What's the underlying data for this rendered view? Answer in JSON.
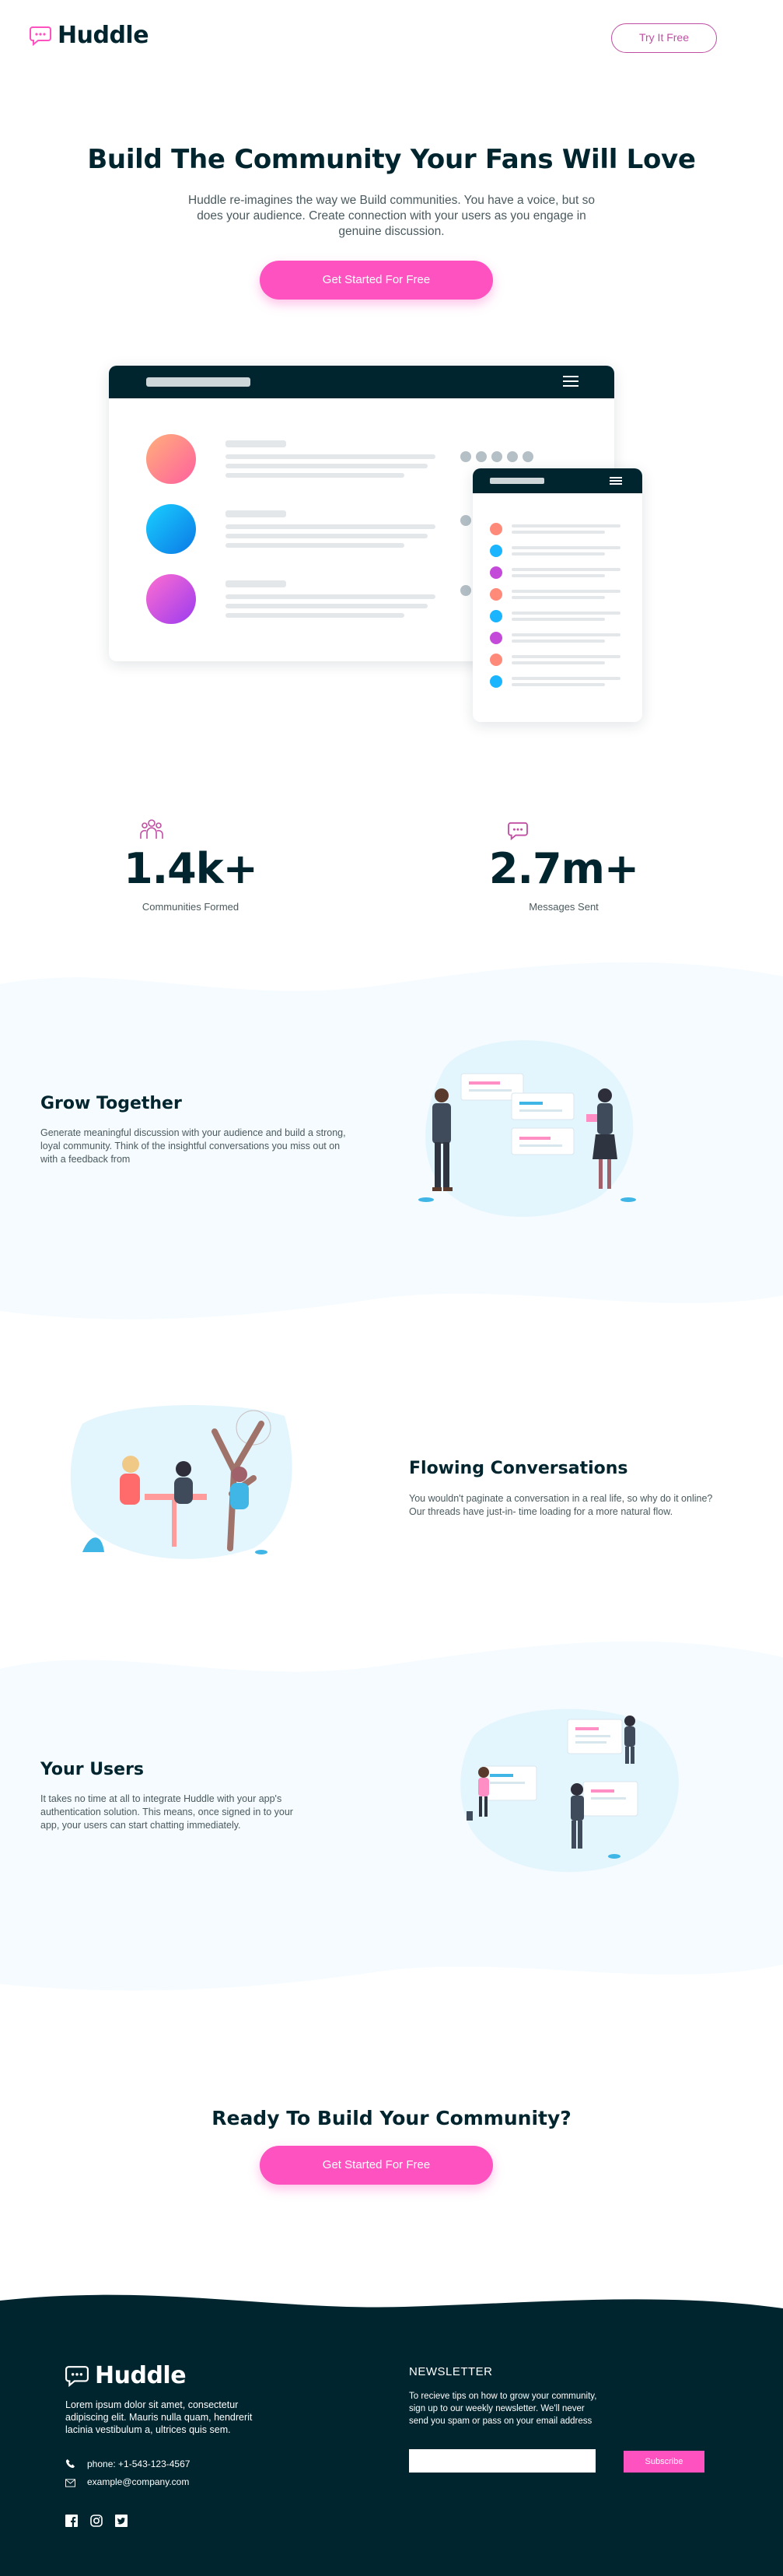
{
  "colors": {
    "dark": "#00252e",
    "pink": "#ff52c1",
    "pink_outline": "#c04fa3",
    "light_bg": "#f5fbff",
    "text": "#4a5a5e"
  },
  "header": {
    "brand": "Huddle",
    "cta": "Try It Free",
    "logo_icon": "chat-bubble-icon"
  },
  "hero": {
    "title": "Build The Community Your Fans Will Love",
    "text": "Huddle re-imagines the way we Build communities. You have a voice, but so does your audience. Create connection with your users as you engage in genuine discussion.",
    "cta": "Get Started For Free"
  },
  "stats": [
    {
      "icon": "communities-icon",
      "value": "1.4k+",
      "label": "Communities Formed"
    },
    {
      "icon": "messages-icon",
      "value": "2.7m+",
      "label": "Messages Sent"
    }
  ],
  "features": [
    {
      "title": "Grow Together",
      "text": "Generate meaningful discussion with your audience and build a strong, loyal community. Think of the insightful conversations you miss out on with a feedback from"
    },
    {
      "title": "Flowing Conversations",
      "text": "You wouldn't paginate a conversation in a real life, so why do it online? Our threads have just-in- time loading for a more natural flow."
    },
    {
      "title": "Your Users",
      "text": "It takes no time at all to integrate Huddle with your app's authentication solution. This means, once signed in to your app, your users can start chatting immediately."
    }
  ],
  "cta": {
    "title": "Ready To Build Your Community?",
    "button": "Get Started For Free"
  },
  "footer": {
    "brand": "Huddle",
    "about": "Lorem ipsum dolor sit amet, consectetur adipiscing elit. Mauris nulla quam, hendrerit lacinia vestibulum a, ultrices quis sem.",
    "phone": "phone: +1-543-123-4567",
    "email": "example@company.com",
    "newsletter_title": "NEWSLETTER",
    "newsletter_text": "To recieve tips on how to grow your community, sign up to our weekly newsletter. We'll never send you spam or pass on your email address",
    "email_placeholder": "",
    "subscribe": "Subscribe",
    "socials": [
      "facebook-icon",
      "instagram-icon",
      "twitter-icon"
    ]
  }
}
